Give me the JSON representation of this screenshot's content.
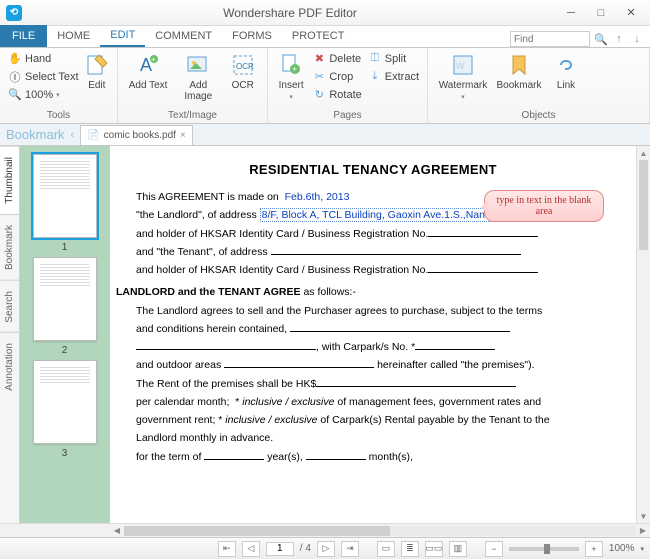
{
  "app": {
    "title": "Wondershare PDF Editor"
  },
  "win": {
    "min": "─",
    "max": "□",
    "close": "✕"
  },
  "menu": {
    "file": "FILE",
    "tabs": [
      "HOME",
      "EDIT",
      "COMMENT",
      "FORMS",
      "PROTECT"
    ],
    "active": "EDIT",
    "find_placeholder": "Find"
  },
  "ribbon": {
    "tools": {
      "label": "Tools",
      "hand": "Hand",
      "select": "Select Text",
      "zoom": "100%",
      "edit_label": "Edit"
    },
    "textimage": {
      "label": "Text/Image",
      "addtext": "Add Text",
      "addimage": "Add Image",
      "ocr": "OCR"
    },
    "pages": {
      "label": "Pages",
      "insert": "Insert",
      "delete": "Delete",
      "crop": "Crop",
      "rotate": "Rotate",
      "split": "Split",
      "extract": "Extract"
    },
    "objects": {
      "label": "Objects",
      "watermark": "Watermark",
      "bookmark": "Bookmark",
      "link": "Link"
    }
  },
  "doctabs": {
    "bookmark": "Bookmark",
    "tab1": "comic books.pdf"
  },
  "side": {
    "thumbnail": "Thumbnail",
    "bookmark": "Bookmark",
    "search": "Search",
    "annotation": "Annotation"
  },
  "pages": {
    "p1": "1",
    "p2": "2",
    "p3": "3"
  },
  "doc": {
    "title": "RESIDENTIAL TENANCY AGREEMENT",
    "l1a": "This AGREEMENT is made on",
    "l1b": "Feb.6th, 2013",
    "l2a": "\"the Landlord\", of address",
    "l2b": "8/F, Block A, TCL Building, Gaoxin Ave.1.S.,NanshanDistrict, Shenzhen",
    "l3": "and holder of HKSAR Identity Card / Business Registration No.",
    "l4": "and \"the Tenant\", of address",
    "l5": "and holder of HKSAR Identity Card / Business Registration No.",
    "l6a": "LANDLORD and the TENANT AGREE",
    "l6b": " as follows:-",
    "l7": "The Landlord agrees to sell and the Purchaser agrees to purchase, subject to the terms",
    "l8": "and conditions herein contained, ",
    "l9a": "",
    "l9b": ", with Carpark/s No. *",
    "l10a": "and outdoor areas ",
    "l10b": " hereinafter called \"the premises\").",
    "l11": "The Rent of the premises shall be HK$",
    "l12": "per calendar month;  * inclusive / exclusive of management fees, government rates and",
    "l13": "government rent; * inclusive / exclusive of Carpark(s) Rental payable by the Tenant to the",
    "l14": "Landlord monthly in advance.",
    "l15a": "for the term of ",
    "l15b": " year(s), ",
    "l15c": " month(s),"
  },
  "callout": "type in text in the blank area",
  "status": {
    "first": "⇤",
    "prev": "◁",
    "next": "▷",
    "last": "⇥",
    "page": "1",
    "pages": "/ 4",
    "zoomout": "−",
    "zoomin": "+",
    "zoom": "100%"
  }
}
